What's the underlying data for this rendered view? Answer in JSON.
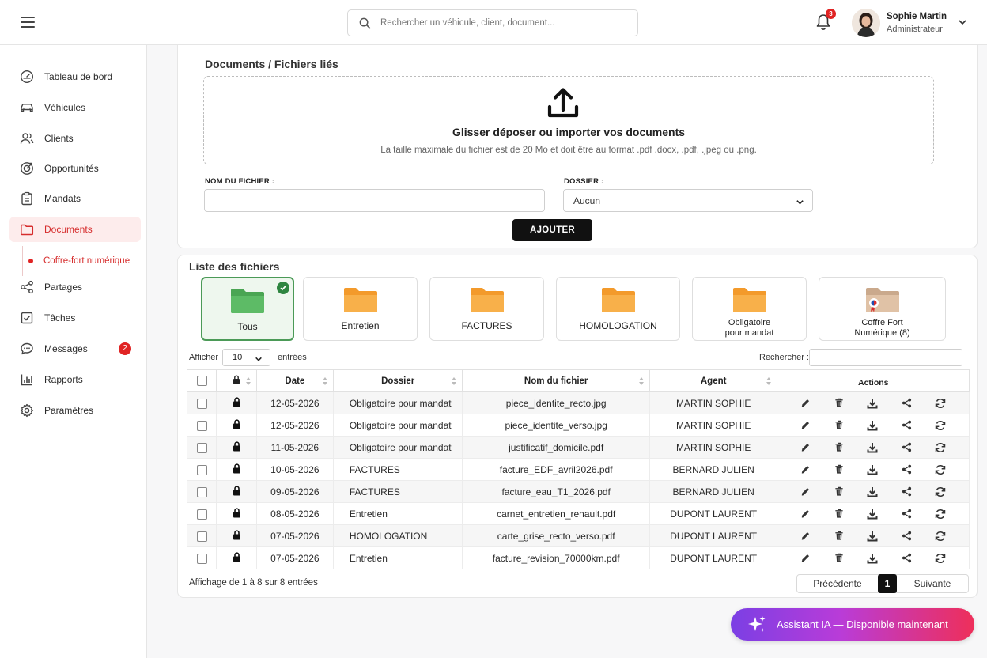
{
  "header": {
    "search_placeholder": "Rechercher un véhicule, client, document...",
    "notifications_count": "3",
    "user_name": "Sophie Martin",
    "user_role": "Administrateur"
  },
  "sidebar": {
    "items": [
      {
        "label": "Tableau de bord",
        "icon": "dashboard-icon"
      },
      {
        "label": "Véhicules",
        "icon": "car-icon"
      },
      {
        "label": "Clients",
        "icon": "users-icon"
      },
      {
        "label": "Opportunités",
        "icon": "target-icon"
      },
      {
        "label": "Mandats",
        "icon": "clipboard-icon"
      },
      {
        "label": "Documents",
        "icon": "folder-icon"
      },
      {
        "label": "Partages",
        "icon": "share-icon"
      },
      {
        "label": "Tâches",
        "icon": "checkbox-icon"
      },
      {
        "label": "Messages",
        "icon": "chat-icon",
        "count": "2"
      },
      {
        "label": "Rapports",
        "icon": "chart-icon"
      },
      {
        "label": "Paramètres",
        "icon": "gear-icon"
      }
    ],
    "sub_item": "Coffre-fort numérique",
    "accent": "#e02424"
  },
  "upload": {
    "title": "Documents / Fichiers liés",
    "drop_title": "Glisser déposer ou importer vos documents",
    "drop_hint": "La taille maximale du fichier est de 20 Mo et doit être au format .pdf .docx, .pdf, .jpeg ou .png.",
    "filename_label": "NOM DU FICHIER :",
    "filename_value": "",
    "folder_label": "DOSSIER :",
    "folder_value": "Aucun",
    "add_button": "AJOUTER"
  },
  "files": {
    "title": "Liste des fichiers",
    "folders": [
      {
        "line1": "Tous",
        "line2": "",
        "selected": true
      },
      {
        "line1": "Entretien",
        "line2": ""
      },
      {
        "line1": "FACTURES",
        "line2": ""
      },
      {
        "line1": "HOMOLOGATION",
        "line2": ""
      },
      {
        "line1": "Obligatoire",
        "line2": "pour mandat"
      },
      {
        "line1": "Coffre Fort",
        "line2": "Numérique (8)"
      }
    ],
    "show_label": "Afficher",
    "show_value": "10",
    "entries_label": "entrées",
    "search_label": "Rechercher :",
    "search_value": "",
    "columns": [
      "Date",
      "Dossier",
      "Nom du fichier",
      "Agent",
      "Actions"
    ],
    "rows": [
      {
        "date": "12-05-2026",
        "folder": "Obligatoire pour mandat",
        "name": "piece_identite_recto.jpg",
        "agent": "MARTIN SOPHIE"
      },
      {
        "date": "12-05-2026",
        "folder": "Obligatoire pour mandat",
        "name": "piece_identite_verso.jpg",
        "agent": "MARTIN SOPHIE"
      },
      {
        "date": "11-05-2026",
        "folder": "Obligatoire pour mandat",
        "name": "justificatif_domicile.pdf",
        "agent": "MARTIN SOPHIE"
      },
      {
        "date": "10-05-2026",
        "folder": "FACTURES",
        "name": "facture_EDF_avril2026.pdf",
        "agent": "BERNARD JULIEN"
      },
      {
        "date": "09-05-2026",
        "folder": "FACTURES",
        "name": "facture_eau_T1_2026.pdf",
        "agent": "BERNARD JULIEN"
      },
      {
        "date": "08-05-2026",
        "folder": "Entretien",
        "name": "carnet_entretien_renault.pdf",
        "agent": "DUPONT LAURENT"
      },
      {
        "date": "07-05-2026",
        "folder": "HOMOLOGATION",
        "name": "carte_grise_recto_verso.pdf",
        "agent": "DUPONT LAURENT"
      },
      {
        "date": "07-05-2026",
        "folder": "Entretien",
        "name": "facture_revision_70000km.pdf",
        "agent": "DUPONT LAURENT"
      }
    ],
    "info": "Affichage de 1 à 8 sur 8 entrées",
    "prev": "Précédente",
    "page": "1",
    "next": "Suivante"
  },
  "assistant": {
    "label": "Assistant IA — Disponible maintenant"
  }
}
